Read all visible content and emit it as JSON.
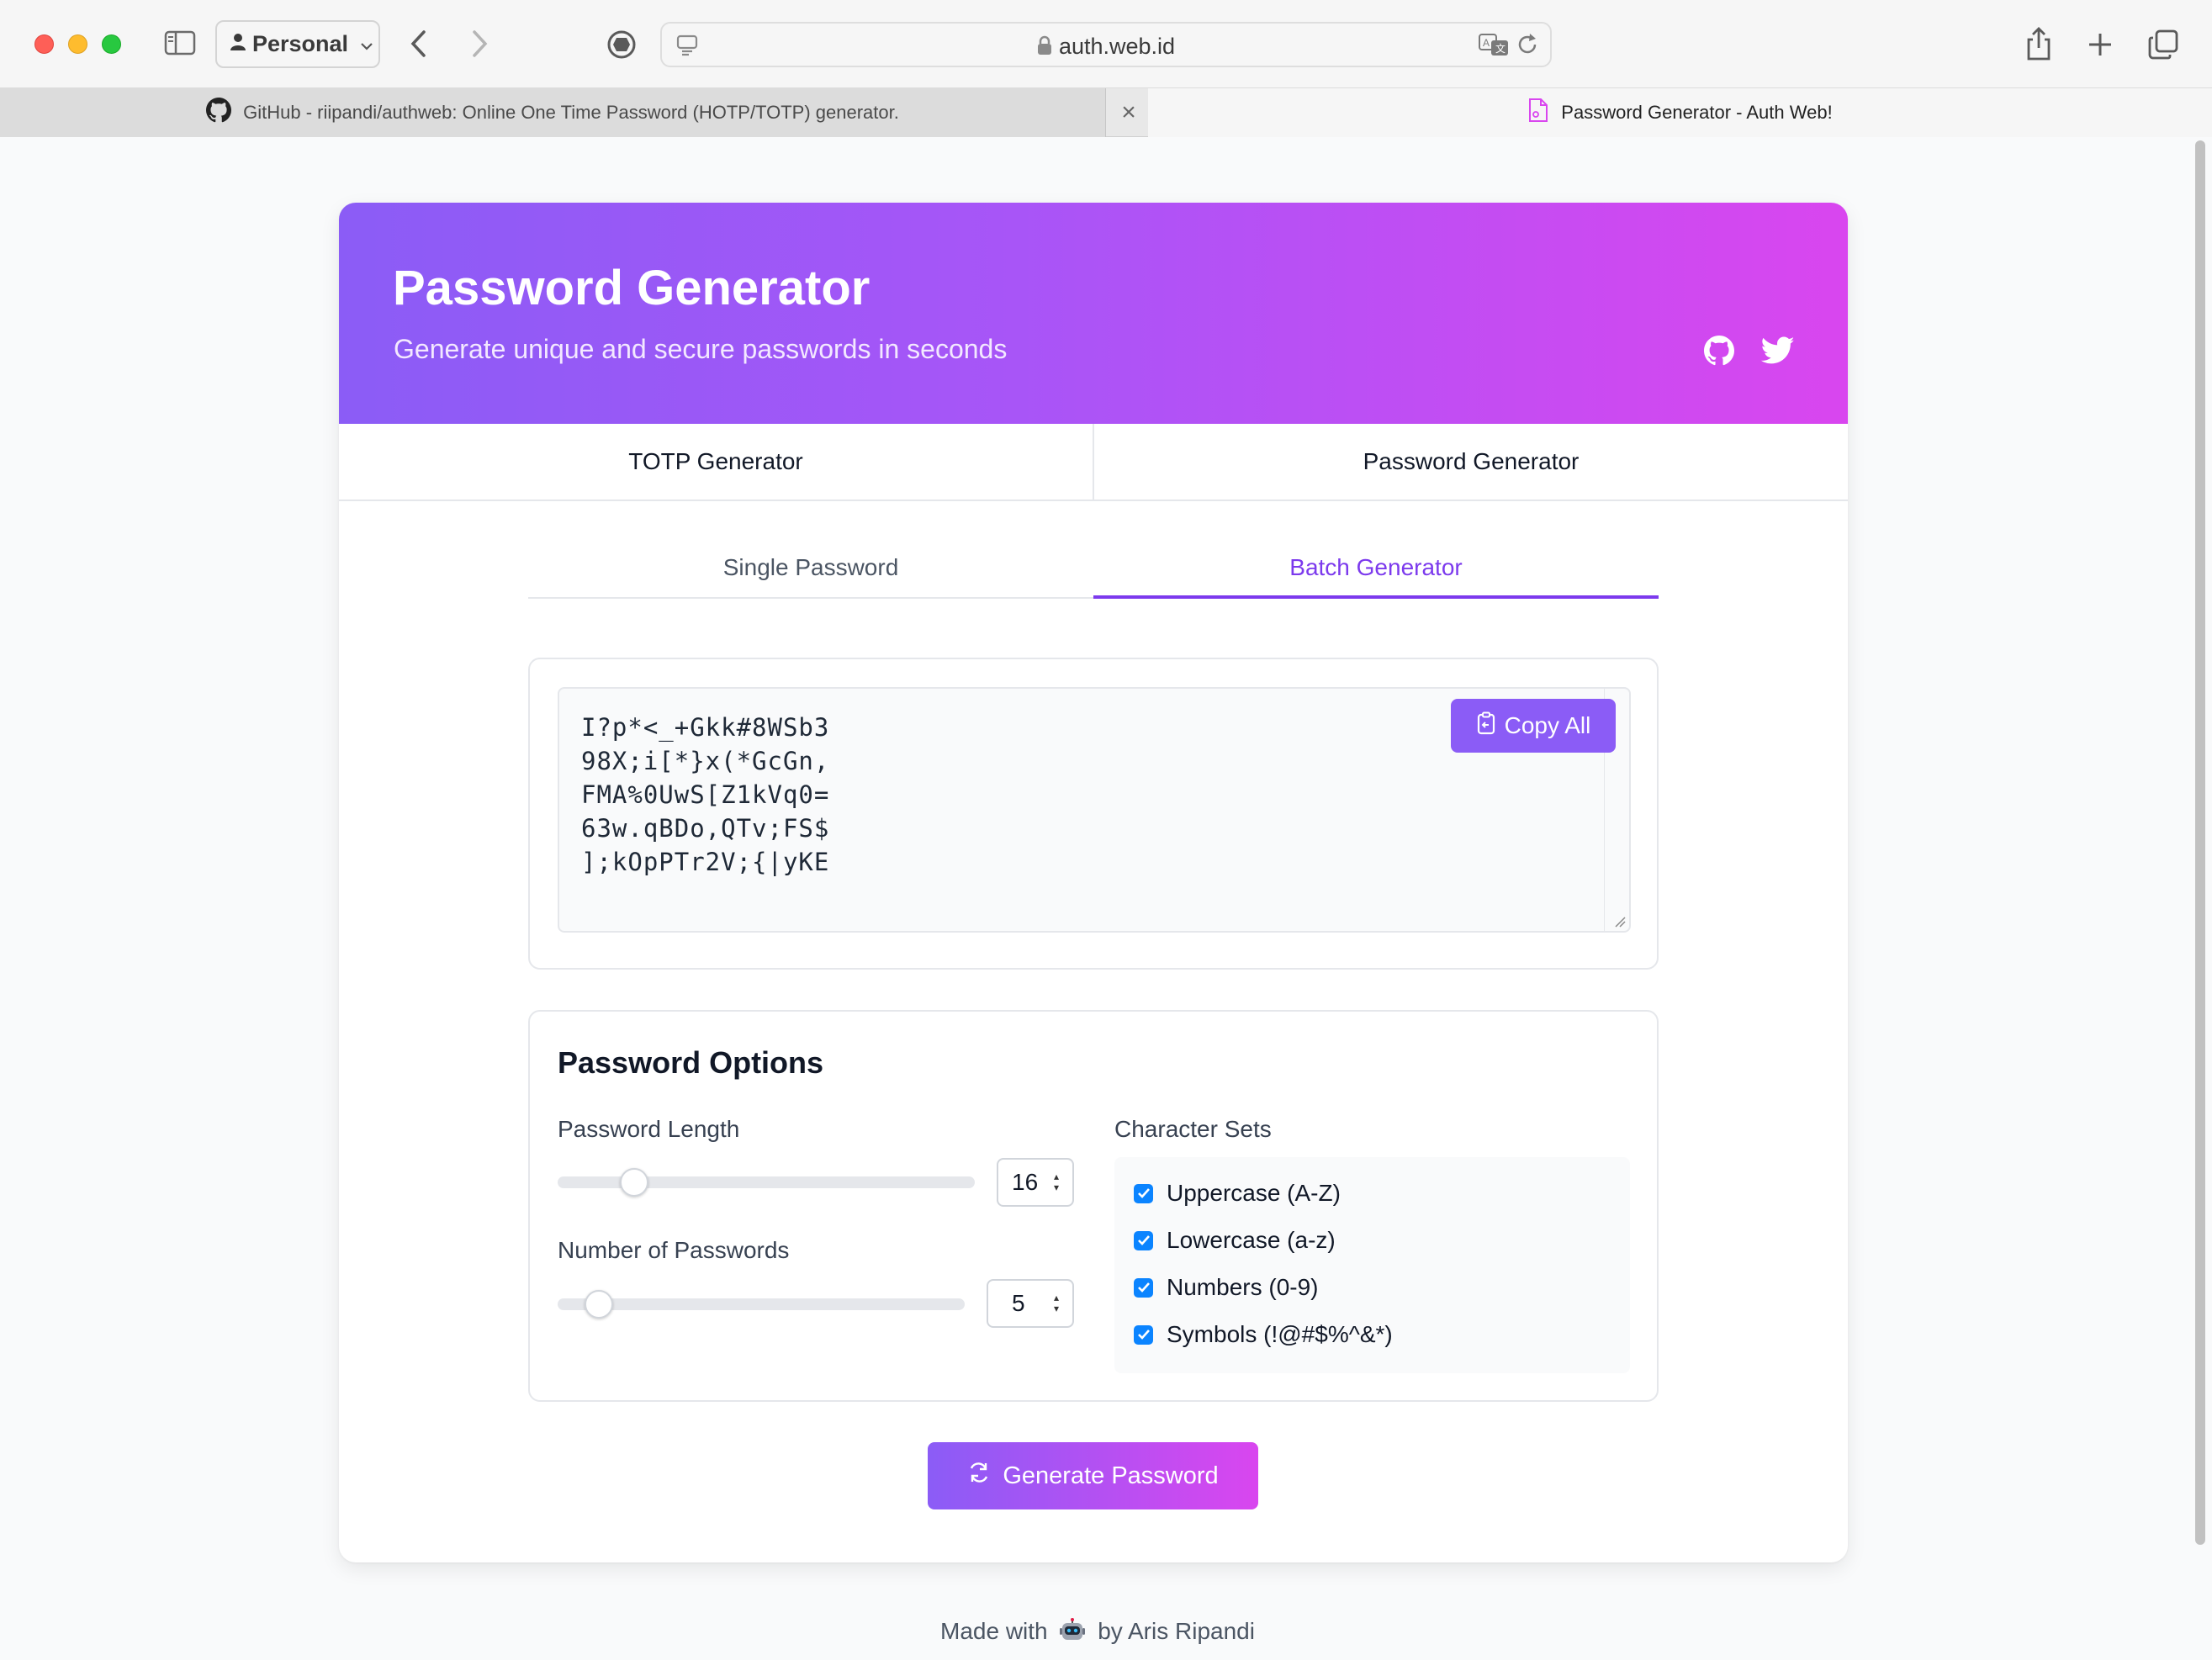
{
  "browser": {
    "profile_label": "Personal",
    "address": "auth.web.id",
    "tabs": [
      {
        "title": "GitHub - riipandi/authweb: Online One Time Password (HOTP/TOTP) generator."
      },
      {
        "title": "Password Generator - Auth Web!"
      }
    ]
  },
  "hero": {
    "title": "Password Generator",
    "subtitle": "Generate unique and secure passwords in seconds"
  },
  "main_tabs": [
    {
      "label": "TOTP Generator"
    },
    {
      "label": "Password Generator"
    }
  ],
  "sub_tabs": [
    {
      "label": "Single Password",
      "active": false
    },
    {
      "label": "Batch Generator",
      "active": true
    }
  ],
  "output": {
    "passwords": [
      "I?p*<_+Gkk#8WSb3",
      "98X;i[*}x(*GcGn,",
      "FMA%0UwS[Z1kVq0=",
      "63w.qBDo,QTv;FS$",
      "];kOpPTr2V;{|yKE"
    ],
    "copy_label": "Copy All"
  },
  "options": {
    "title": "Password Options",
    "length_label": "Password Length",
    "length_value": "16",
    "length_level": 0.16,
    "count_label": "Number of Passwords",
    "count_value": "5",
    "count_level": 0.07,
    "charsets_label": "Character Sets",
    "charsets": [
      {
        "label": "Uppercase (A-Z)",
        "checked": true
      },
      {
        "label": "Lowercase (a-z)",
        "checked": true
      },
      {
        "label": "Numbers (0-9)",
        "checked": true
      },
      {
        "label": "Symbols (!@#$%^&*)",
        "checked": true
      }
    ]
  },
  "generate_label": "Generate Password",
  "footer": {
    "prefix": "Made with",
    "suffix": "by Aris Ripandi"
  },
  "colors": {
    "accent": "#7c3aed",
    "gradient_start": "#8b5cf6",
    "gradient_end": "#d946ef",
    "checkbox": "#0b84ff"
  }
}
